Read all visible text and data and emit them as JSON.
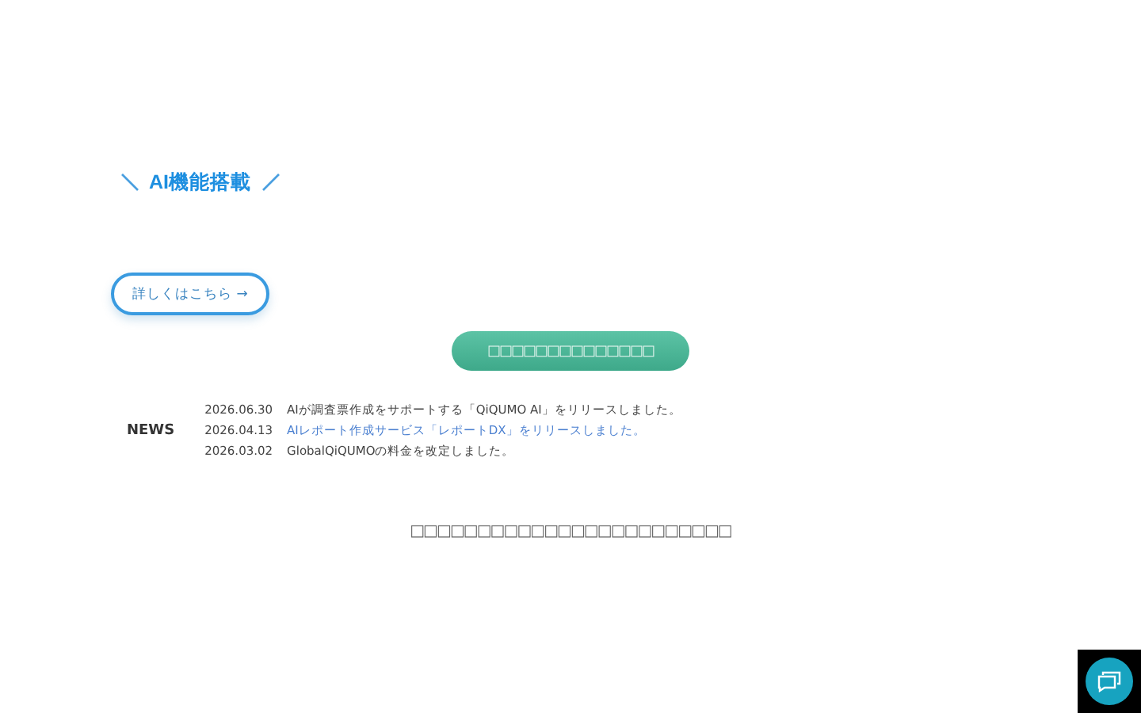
{
  "hero": {
    "badge": "AI機能搭載",
    "more_button": "詳しくはこちら →",
    "cta_button": "□□□□□□□□□□□□□□"
  },
  "news": {
    "heading": "NEWS",
    "items": [
      {
        "date": "2026.06.30",
        "text": "AIが調査票作成をサポートする「QiQUMO AI」をリリースしました。",
        "kind": "plain"
      },
      {
        "date": "2026.04.13",
        "text": "AIレポート作成サービス「レポートDX」をリリースしました。",
        "kind": "link"
      },
      {
        "date": "2026.03.02",
        "text": "GlobalQiQUMOの料金を改定しました。",
        "kind": "plain"
      }
    ]
  },
  "footer_text": "□□□□□□□□□□□□□□□□□□□□□□□□"
}
